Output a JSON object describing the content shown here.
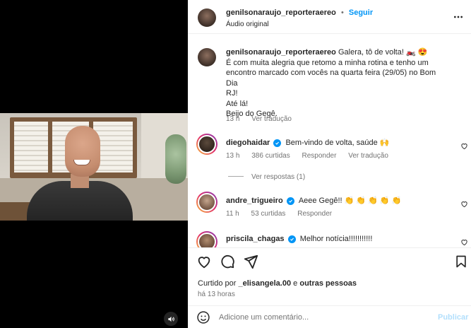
{
  "post": {
    "username": "genilsonaraujo_reporteraereo",
    "dot": "•",
    "follow_label": "Seguir",
    "audio_label": "Áudio original",
    "more_icon": "more-horizontal-icon"
  },
  "caption": {
    "username": "genilsonaraujo_reporteraereo",
    "text_line1": "Galera, tô de volta! 🏍️ 😍",
    "lines": [
      "É com muita alegria que retomo a minha rotina e tenho um",
      "encontro marcado com vocês na quarta feira (29/05) no Bom Dia",
      "RJ!",
      "Até lá!",
      "Beijo do Gegê."
    ],
    "time": "13 h",
    "translate": "Ver tradução"
  },
  "comments": [
    {
      "username": "diegohaidar",
      "text": "Bem-vindo de volta, saúde 🙌",
      "time": "13 h",
      "likes": "386 curtidas",
      "reply": "Responder",
      "translate": "Ver tradução",
      "replies_label": "Ver respostas (1)"
    },
    {
      "username": "andre_trigueiro",
      "text": "Aeee Gegê!! 👏 👏 👏 👏 👏",
      "time": "11 h",
      "likes": "53 curtidas",
      "reply": "Responder"
    },
    {
      "username": "priscila_chagas",
      "text": "Melhor notícia!!!!!!!!!!!"
    }
  ],
  "engagement": {
    "liked_by_prefix": "Curtido por",
    "liked_by_user": "_elisangela.00",
    "liked_by_suffix": "e",
    "liked_by_others": "outras pessoas",
    "time_ago": "há 13 horas"
  },
  "add_comment": {
    "placeholder": "Adicione um comentário...",
    "publish_label": "Publicar"
  },
  "colors": {
    "accent": "#0095f6",
    "text": "#262626",
    "muted": "#737373"
  }
}
